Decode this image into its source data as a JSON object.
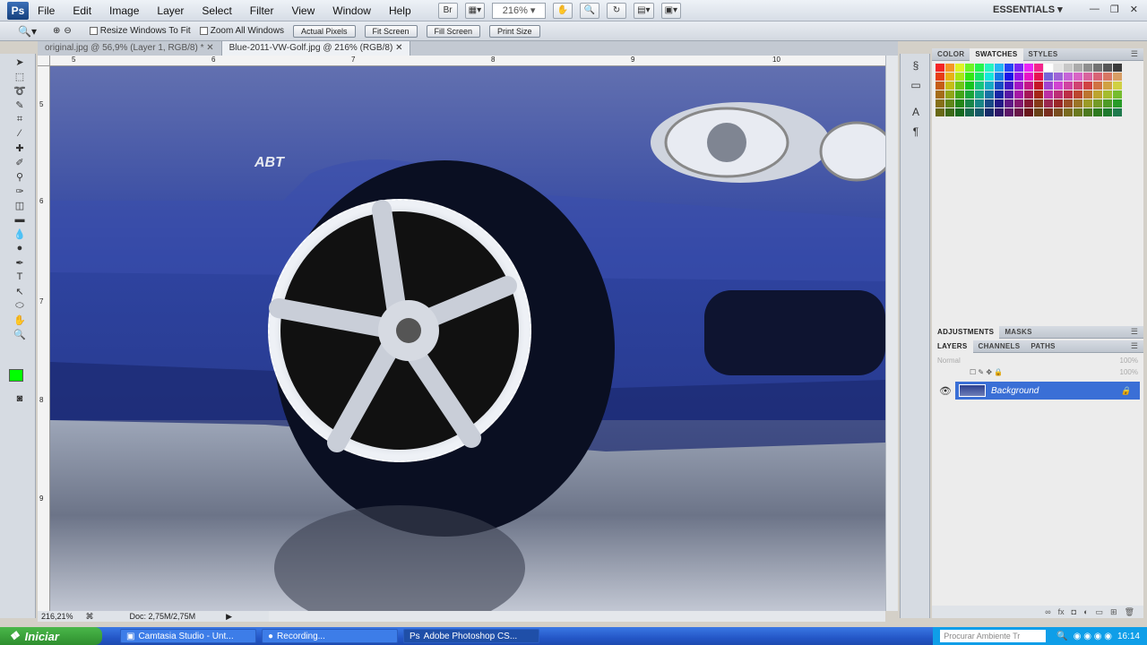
{
  "menubar": {
    "logo": "Ps",
    "items": [
      "File",
      "Edit",
      "Image",
      "Layer",
      "Select",
      "Filter",
      "View",
      "Window",
      "Help"
    ],
    "zoom": "216%",
    "workspace": "ESSENTIALS",
    "br_label": "Br"
  },
  "options": {
    "resize_label": "Resize Windows To Fit",
    "zoom_all_label": "Zoom All Windows",
    "actual_pixels": "Actual Pixels",
    "fit_screen": "Fit Screen",
    "fill_screen": "Fill Screen",
    "print_size": "Print Size"
  },
  "tabs": [
    {
      "label": "original.jpg @ 56,9% (Layer 1, RGB/8) *"
    },
    {
      "label": "Blue-2011-VW-Golf.jpg @ 216% (RGB/8)"
    }
  ],
  "ruler": {
    "h_ticks": [
      "5",
      "6",
      "7",
      "8",
      "9",
      "10"
    ],
    "v_ticks": [
      "5",
      "6",
      "7",
      "8",
      "9"
    ]
  },
  "status": {
    "zoom": "216,21%",
    "doc": "Doc: 2,75M/2,75M"
  },
  "panels": {
    "color_tab": "COLOR",
    "swatches_tab": "SWATCHES",
    "styles_tab": "STYLES",
    "adjustments_tab": "ADJUSTMENTS",
    "masks_tab": "MASKS",
    "layers_tab": "LAYERS",
    "channels_tab": "CHANNELS",
    "paths_tab": "PATHS",
    "blend_mode": "Normal",
    "opacity": "100%",
    "fill": "100%",
    "layer_name": "Background"
  },
  "taskbar": {
    "start": "Iniciar",
    "tasks": [
      "Camtasia Studio - Unt...",
      "Recording...",
      "Adobe Photoshop CS..."
    ],
    "search_placeholder": "Procurar Ambiente Tr",
    "clock": "16:14"
  },
  "colors": {
    "foreground": "#00ff00",
    "car_blue": "#2b3f9a",
    "selection_blue": "#3a6fd6"
  }
}
